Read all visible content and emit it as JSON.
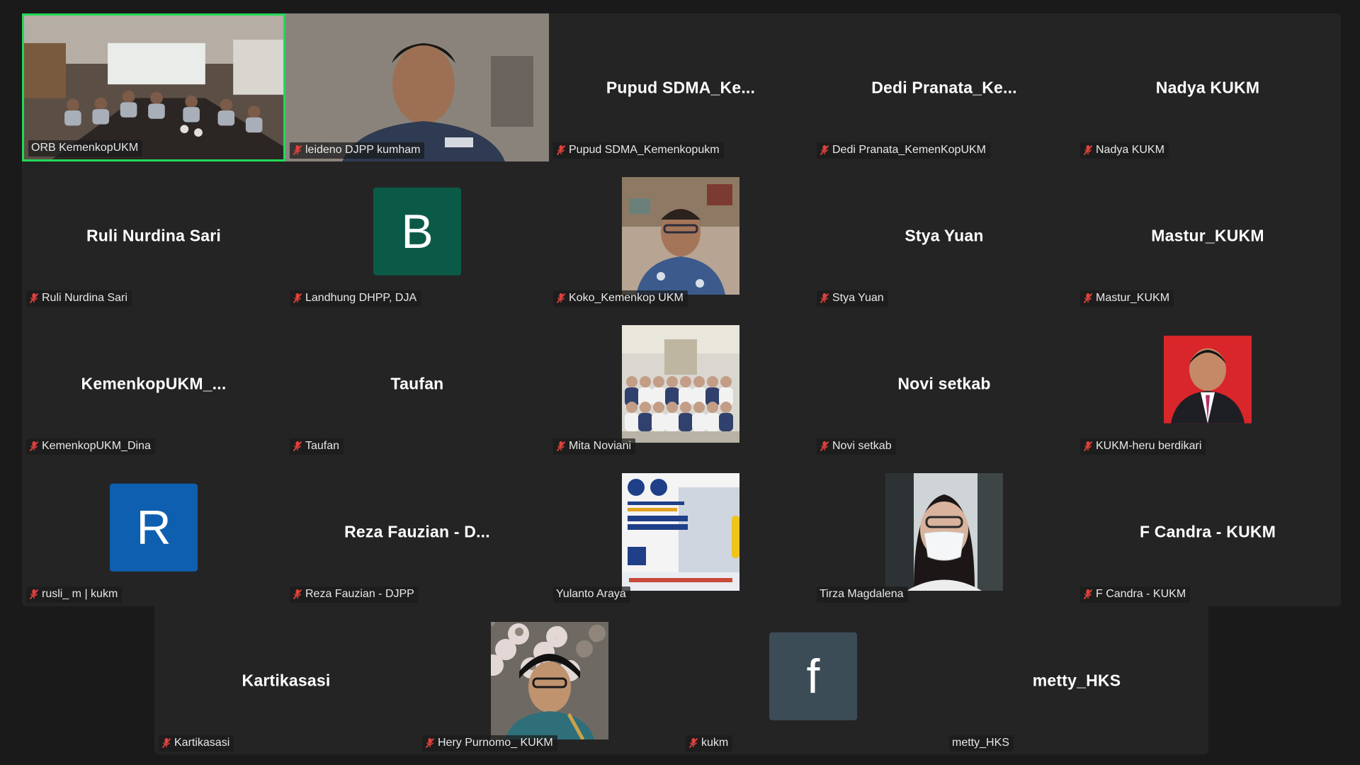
{
  "meeting": {
    "active_speaker": "ORB KemenkopUKM",
    "colors": {
      "active_border": "#23d959",
      "muted_icon": "#e0413c",
      "tile_bg": "#242424"
    }
  },
  "participants": [
    {
      "label": "ORB KemenkopUKM",
      "kind": "video",
      "muted": false,
      "active": true
    },
    {
      "label": "leideno DJPP kumham",
      "kind": "video",
      "muted": true
    },
    {
      "label": "Pupud SDMA_Kemenkopukm",
      "display": "Pupud  SDMA_Ke...",
      "kind": "name",
      "muted": true
    },
    {
      "label": "Dedi Pranata_KemenKopUKM",
      "display": "Dedi  Pranata_Ke...",
      "kind": "name",
      "muted": true
    },
    {
      "label": "Nadya KUKM",
      "display": "Nadya KUKM",
      "kind": "name",
      "muted": true
    },
    {
      "label": "Ruli Nurdina Sari",
      "display": "Ruli Nurdina Sari",
      "kind": "name",
      "muted": true
    },
    {
      "label": "Landhung DHPP, DJA",
      "letter": "B",
      "avatar_color": "#0b5a47",
      "kind": "letter",
      "muted": true
    },
    {
      "label": "Koko_Kemenkop UKM",
      "kind": "photo",
      "muted": true
    },
    {
      "label": "Stya Yuan",
      "display": "Stya Yuan",
      "kind": "name",
      "muted": true
    },
    {
      "label": "Mastur_KUKM",
      "display": "Mastur_KUKM",
      "kind": "name",
      "muted": true
    },
    {
      "label": "KemenkopUKM_Dina",
      "display": "KemenkopUKM_...",
      "kind": "name",
      "muted": true
    },
    {
      "label": "Taufan",
      "display": "Taufan",
      "kind": "name",
      "muted": true
    },
    {
      "label": "Mita Noviani",
      "kind": "photo",
      "muted": true
    },
    {
      "label": "Novi setkab",
      "display": "Novi setkab",
      "kind": "name",
      "muted": true
    },
    {
      "label": "KUKM-heru berdikari",
      "kind": "photo-small",
      "muted": true
    },
    {
      "label": "rusli_ m | kukm",
      "letter": "R",
      "avatar_color": "#0e5fb0",
      "kind": "letter",
      "muted": true
    },
    {
      "label": "Reza Fauzian - DJPP",
      "display": "Reza Fauzian - D...",
      "kind": "name",
      "muted": true
    },
    {
      "label": "Yulanto Araya",
      "kind": "photo",
      "muted": false
    },
    {
      "label": "Tirza Magdalena",
      "kind": "photo",
      "muted": false
    },
    {
      "label": "F Candra - KUKM",
      "display": "F Candra - KUKM",
      "kind": "name",
      "muted": true
    },
    {
      "label": "Kartikasasi",
      "display": "Kartikasasi",
      "kind": "name",
      "muted": true
    },
    {
      "label": "Hery Purnomo_ KUKM",
      "kind": "photo",
      "muted": true
    },
    {
      "label": "kukm",
      "letter": "f",
      "avatar_color": "#3c4c56",
      "kind": "letter",
      "muted": true
    },
    {
      "label": "metty_HKS",
      "display": "metty_HKS",
      "kind": "name",
      "muted": false
    }
  ]
}
